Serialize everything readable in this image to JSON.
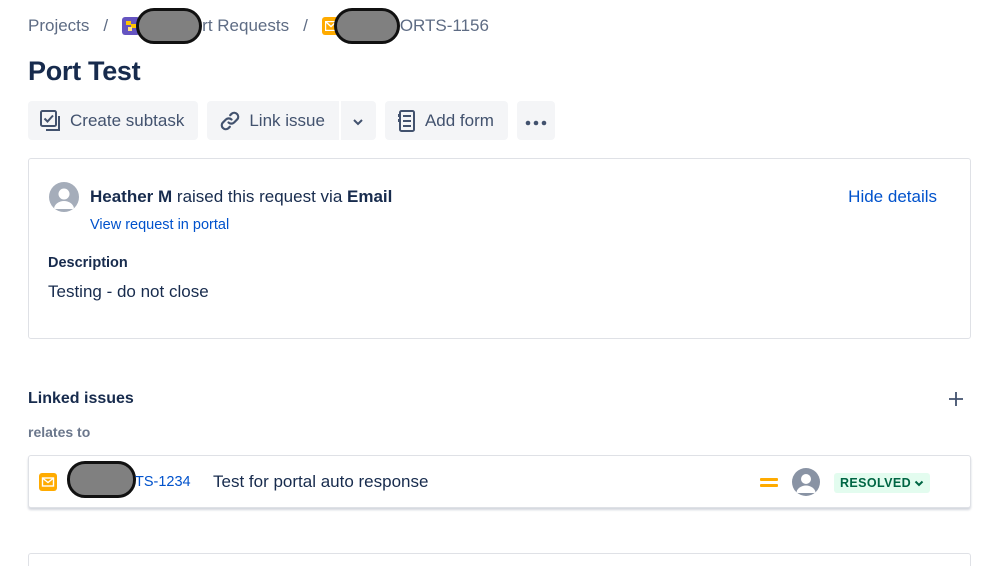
{
  "breadcrumb": {
    "projects": "Projects",
    "separator": "/",
    "project_name_visible": "rt Requests",
    "issue_key_visible": "ORTS-1156"
  },
  "issue": {
    "title": "Port Test"
  },
  "toolbar": {
    "create_subtask": "Create subtask",
    "link_issue": "Link issue",
    "add_form": "Add form"
  },
  "request": {
    "reporter": "Heather M",
    "raised_text": " raised this request via ",
    "channel": "Email",
    "view_portal": "View request in portal",
    "hide_details": "Hide details",
    "description_label": "Description",
    "description": "Testing - do not close"
  },
  "linked_issues": {
    "title": "Linked issues",
    "relation": "relates to",
    "items": [
      {
        "key_visible": "TS-1234",
        "summary": "Test for portal auto response",
        "priority": "medium",
        "status": "RESOLVED",
        "status_color": "#006644",
        "status_bg": "#e3fcef"
      }
    ]
  },
  "colors": {
    "link": "#0052cc",
    "text": "#172b4d",
    "muted": "#5e6c84",
    "priority_medium": "#ffab00",
    "email_icon": "#ffab00",
    "project_icon": "#6554c0"
  }
}
